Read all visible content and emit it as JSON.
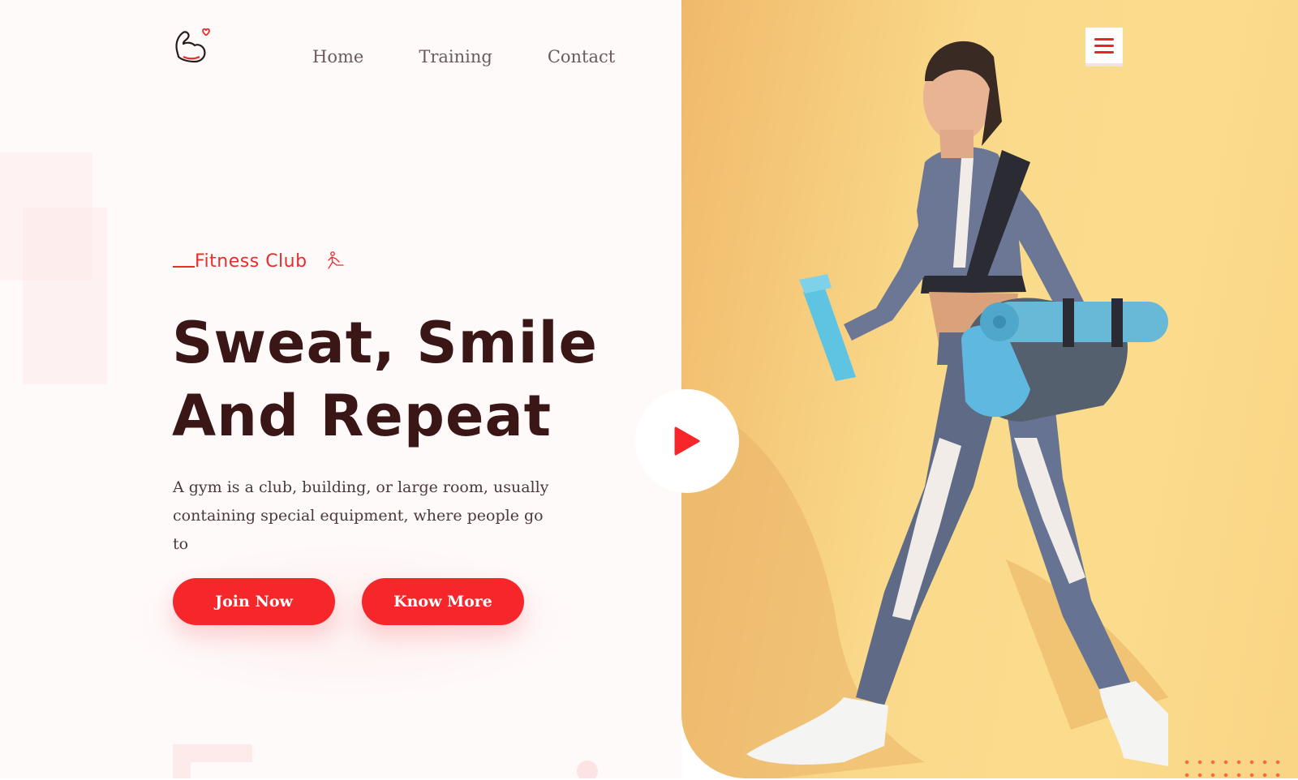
{
  "nav": {
    "items": [
      {
        "label": "Home"
      },
      {
        "label": "Training"
      },
      {
        "label": "Contact"
      }
    ]
  },
  "hero": {
    "eyebrow": "Fitness Club",
    "headline_line1": "Sweat, Smile",
    "headline_line2": "And Repeat",
    "description": "A gym is a club, building, or large room, usually containing special equipment, where people go to",
    "join_button": "Join Now",
    "know_button": "Know More"
  },
  "icons": {
    "logo": "flexed-arm-heart-icon",
    "eyebrow": "runner-icon",
    "menu": "hamburger-menu-icon",
    "play": "play-icon"
  },
  "colors": {
    "accent": "#f5272a",
    "heading": "#3a1617",
    "hero_background": "#fbdc8d"
  }
}
